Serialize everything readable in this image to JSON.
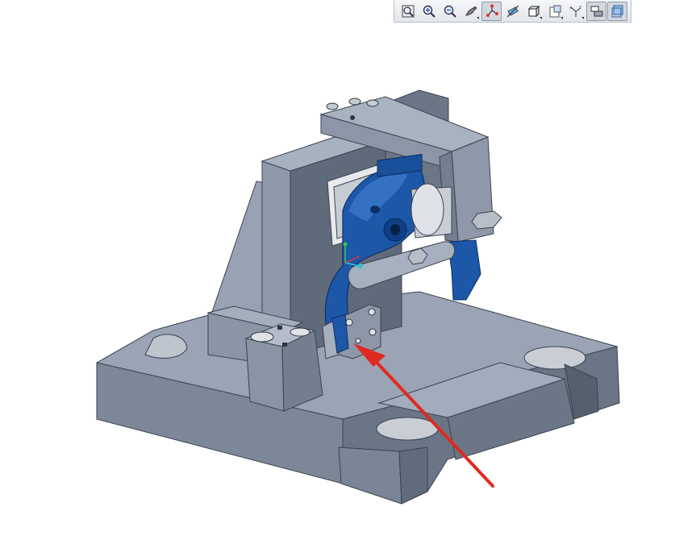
{
  "colors": {
    "background": "#ffffff",
    "body_light": "#9aa4b4",
    "body_mid": "#7f8a9b",
    "body_dark": "#5e6878",
    "clamp_blue": "#1d57a8",
    "arrow_red": "#e02a1f",
    "toolbar_bg": "#eceef1"
  },
  "toolbar": {
    "buttons": [
      {
        "icon": "zoom-fit-icon",
        "active": false
      },
      {
        "icon": "zoom-in-icon",
        "active": false
      },
      {
        "icon": "zoom-out-icon",
        "active": false
      },
      {
        "icon": "view-orient-icon",
        "active": false
      },
      {
        "icon": "datum-display-icon",
        "active": true
      },
      {
        "icon": "axis-display-icon",
        "active": false
      },
      {
        "icon": "display-style-icon",
        "active": false
      },
      {
        "icon": "saved-views-icon",
        "active": false
      },
      {
        "icon": "csys-display-icon",
        "active": false
      },
      {
        "icon": "spin-center-icon",
        "active": true
      },
      {
        "icon": "shaded-edges-icon",
        "active": true
      }
    ]
  },
  "scene": {
    "model": "fixture-assembly",
    "annotation": "red-pointer-arrow"
  }
}
